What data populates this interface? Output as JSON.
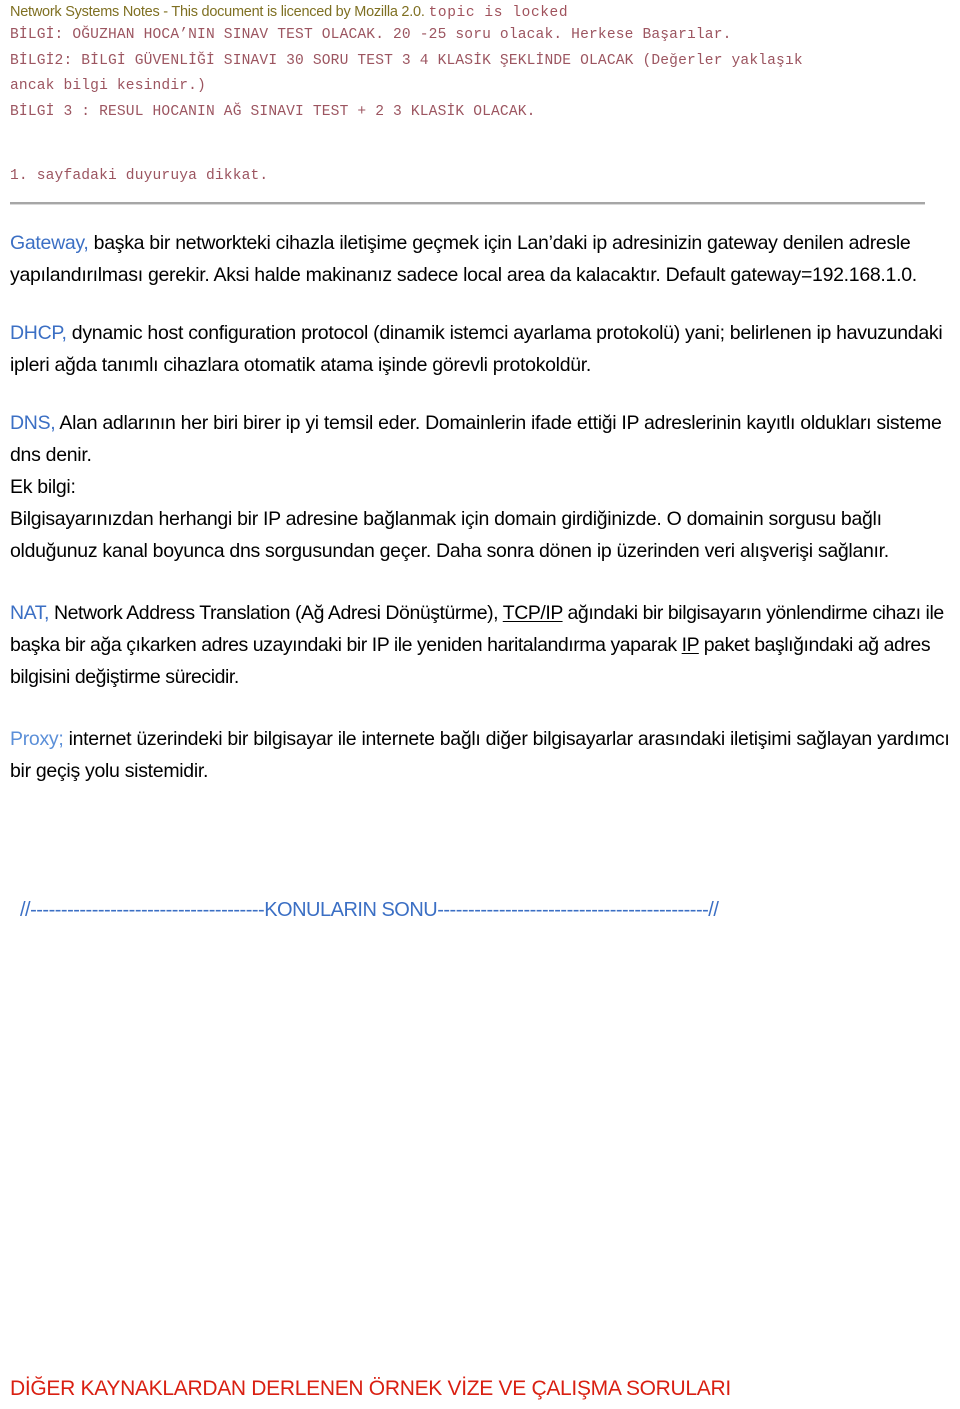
{
  "header": {
    "title": "Network Systems Notes - This document is licenced by Mozilla 2.0.",
    "locked_status": "topic is locked",
    "title_color": "#7f7022",
    "locked_color": "#a0525c"
  },
  "announcements": {
    "color": "#9c5560",
    "lines": [
      "BİLGİ: OĞUZHAN HOCA’NIN SINAV TEST OLACAK. 20 -25 soru olacak. Herkese Başarılar.",
      "BİLGİ2: BİLGİ GÜVENLİĞİ SINAVI 30 SORU TEST 3 4 KLASİK ŞEKLİNDE OLACAK (Değerler yaklaşık",
      "ancak bilgi kesindir.)",
      "BİLGİ 3 : RESUL HOCANIN AĞ SINAVI TEST + 2 3 KLASİK OLACAK."
    ],
    "note": "1. sayfadaki duyuruya dikkat."
  },
  "sections": {
    "gateway": {
      "keyword": "Gateway,",
      "keyword_color": "#3b6fc4",
      "text": " başka bir networkteki cihazla iletişime geçmek için Lan’daki ip adresinizin gateway denilen adresle yapılandırılması gerekir. Aksi halde makinanız sadece local area da kalacaktır.  Default gateway=192.168.1.0."
    },
    "dhcp": {
      "keyword": "DHCP,",
      "keyword_color": "#3b6fc4",
      "text": " dynamic host configuration protocol (dinamik istemci ayarlama protokolü) yani; belirlenen ip havuzundaki ipleri ağda tanımlı cihazlara otomatik atama işinde görevli protokoldür."
    },
    "dns": {
      "keyword": "DNS,",
      "keyword_color": "#3b6fc4",
      "text": " Alan adlarının her biri birer ip yi temsil eder. Domainlerin ifade ettiği IP adreslerinin kayıtlı oldukları sisteme dns denir.",
      "extra_label": "Ek bilgi:",
      "extra_text": "Bilgisayarınızdan herhangi bir IP adresine bağlanmak için domain girdiğinizde. O domainin sorgusu bağlı olduğunuz kanal boyunca dns sorgusundan geçer. Daha sonra dönen ip üzerinden veri alışverişi sağlanır."
    },
    "nat": {
      "keyword": "NAT,",
      "keyword_color": "#3b6fc4",
      "text_part1": " Network Address Translation (Ağ Adresi Dönüştürme), ",
      "link1": "TCP/IP",
      "text_part2": " ağındaki bir bilgisayarın yönlendirme cihazı ile başka bir ağa çıkarken adres uzayındaki bir IP ile yeniden haritalandırma yaparak ",
      "link2": "IP",
      "text_part3": " paket başlığındaki ağ adres bilgisini değiştirme sürecidir."
    },
    "proxy": {
      "keyword": "Proxy;",
      "keyword_color": "#5b8fd8",
      "text": " internet üzerindeki bir bilgisayar ile internete bağlı diğer bilgisayarlar arasındaki iletişimi sağlayan yardımcı bir geçiş yolu sistemidir."
    }
  },
  "end_banner": {
    "text": "//--------------------------------------KONULARIN SONU--------------------------------------------//",
    "color": "#3b6fc4"
  },
  "footer": {
    "text": "DİĞER KAYNAKLARDAN DERLENEN ÖRNEK VİZE VE ÇALIŞMA SORULARI",
    "color": "#d91f11"
  }
}
